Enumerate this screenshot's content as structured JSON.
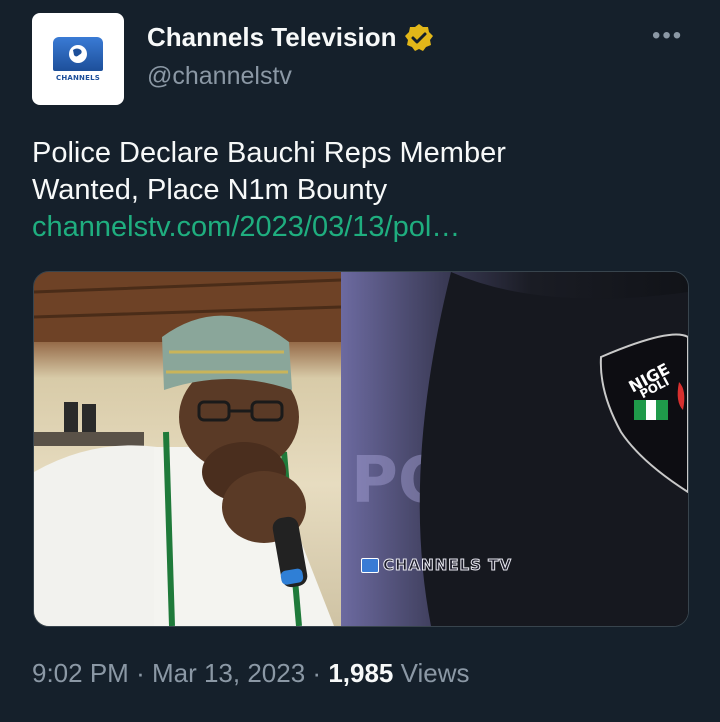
{
  "author": {
    "name": "Channels Television",
    "handle": "@channelstv",
    "avatar_text": "CHANNELS",
    "verified_icon": "gold-verified-badge-icon"
  },
  "more_icon": "•••",
  "tweet": {
    "text_line1": "Police Declare Bauchi Reps Member",
    "text_line2": "Wanted, Place N1m Bounty",
    "link": "channelstv.com/2023/03/13/pol…"
  },
  "media": {
    "watermark": "CHANNELS TV"
  },
  "meta": {
    "time": "9:02 PM",
    "date": "Mar 13, 2023",
    "separator": "·",
    "views_count": "1,985",
    "views_label": "Views"
  },
  "colors": {
    "background": "#15202b",
    "link": "#1fae7f",
    "secondary_text": "#8b98a5",
    "verified_gold": "#e2b719"
  }
}
